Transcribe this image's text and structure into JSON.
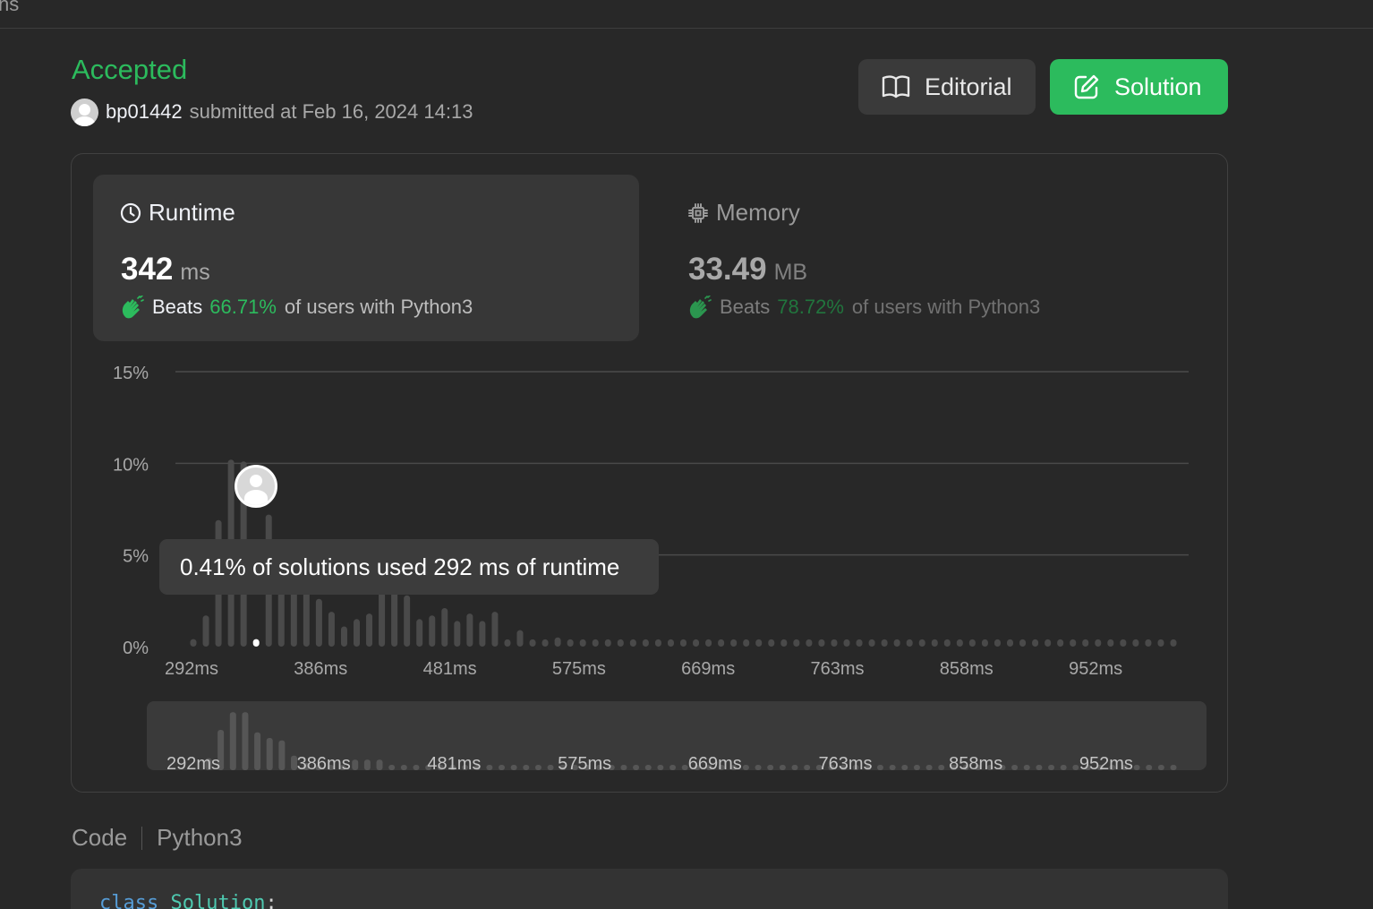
{
  "topbar": {
    "fragment": "ns"
  },
  "submission": {
    "status": "Accepted",
    "username": "bp01442",
    "submitted_text": "submitted at Feb 16, 2024 14:13"
  },
  "actions": {
    "editorial_label": "Editorial",
    "solution_label": "Solution"
  },
  "runtime": {
    "title": "Runtime",
    "value": "342",
    "unit": "ms",
    "beats_label": "Beats",
    "beats_pct": "66.71%",
    "beats_suffix": "of users with Python3"
  },
  "memory": {
    "title": "Memory",
    "value": "33.49",
    "unit": "MB",
    "beats_label": "Beats",
    "beats_pct": "78.72%",
    "beats_suffix": "of users with Python3"
  },
  "tooltip": {
    "text": "0.41% of solutions used 292 ms of runtime"
  },
  "code": {
    "label": "Code",
    "language": "Python3",
    "line_keyword": "class",
    "line_name": "Solution",
    "line_punct": ":"
  },
  "colors": {
    "accent_green": "#2cbb5d",
    "bar_gray": "#4a4a4a",
    "bar_selected": "#ffffff"
  },
  "chart_data": {
    "type": "bar",
    "ylabel_ticks": [
      "0%",
      "5%",
      "10%",
      "15%"
    ],
    "ylim": [
      0,
      15
    ],
    "x_tick_labels": [
      "292ms",
      "386ms",
      "481ms",
      "575ms",
      "669ms",
      "763ms",
      "858ms",
      "952ms"
    ],
    "selected_index": 5,
    "values": [
      0.41,
      1.7,
      6.9,
      10.2,
      10.1,
      0.41,
      7.2,
      5.2,
      4.9,
      3.9,
      2.6,
      1.9,
      1.1,
      1.5,
      1.8,
      4.9,
      5.3,
      2.8,
      1.5,
      1.7,
      2.1,
      1.4,
      1.8,
      1.4,
      1.9,
      0.4,
      0.9,
      0.4,
      0.4,
      0.5,
      0.4,
      0.4,
      0.4,
      0.4,
      0.4,
      0.4,
      0.4,
      0.4,
      0.4,
      0.4,
      0.4,
      0.4,
      0.4,
      0.4,
      0.4,
      0.4,
      0.4,
      0.4,
      0.4,
      0.4,
      0.4,
      0.4,
      0.4,
      0.4,
      0.4,
      0.4,
      0.4,
      0.4,
      0.4,
      0.4,
      0.4,
      0.4,
      0.4,
      0.4,
      0.4,
      0.4,
      0.4,
      0.4,
      0.4,
      0.4,
      0.4,
      0.4,
      0.4,
      0.4,
      0.4,
      0.4,
      0.4,
      0.4,
      0.4
    ],
    "overview": {
      "x_tick_labels": [
        "292ms",
        "386ms",
        "481ms",
        "575ms",
        "669ms",
        "763ms",
        "858ms",
        "952ms"
      ],
      "values": [
        1.5,
        5.0,
        7.2,
        7.2,
        4.7,
        4.0,
        3.7,
        1.8,
        0.9,
        0.5,
        0.5,
        0.5,
        1.3,
        1.3,
        1.3,
        0.5,
        0.5,
        0.5,
        0.5,
        0.5,
        0.5,
        0.5,
        0.5,
        0.5,
        0.5,
        0.5,
        0.5,
        0.5,
        0.5,
        0.5,
        0.5,
        0.5,
        0.5,
        0.5,
        0.5,
        0.5,
        0.5,
        0.5,
        0.5,
        0.5,
        0.5,
        0.5,
        0.5,
        0.5,
        0.5,
        0.5,
        0.5,
        0.5,
        0.5,
        0.5,
        0.5,
        0.5,
        0.5,
        0.5,
        0.5,
        0.5,
        0.5,
        0.5,
        0.5,
        0.5,
        0.5,
        0.5,
        0.5,
        0.5,
        0.5,
        0.5,
        0.5,
        0.5,
        0.5,
        0.5,
        0.5,
        0.5,
        0.5,
        0.5,
        0.5,
        0.5,
        0.5,
        0.5,
        0.5,
        0.5
      ]
    }
  }
}
